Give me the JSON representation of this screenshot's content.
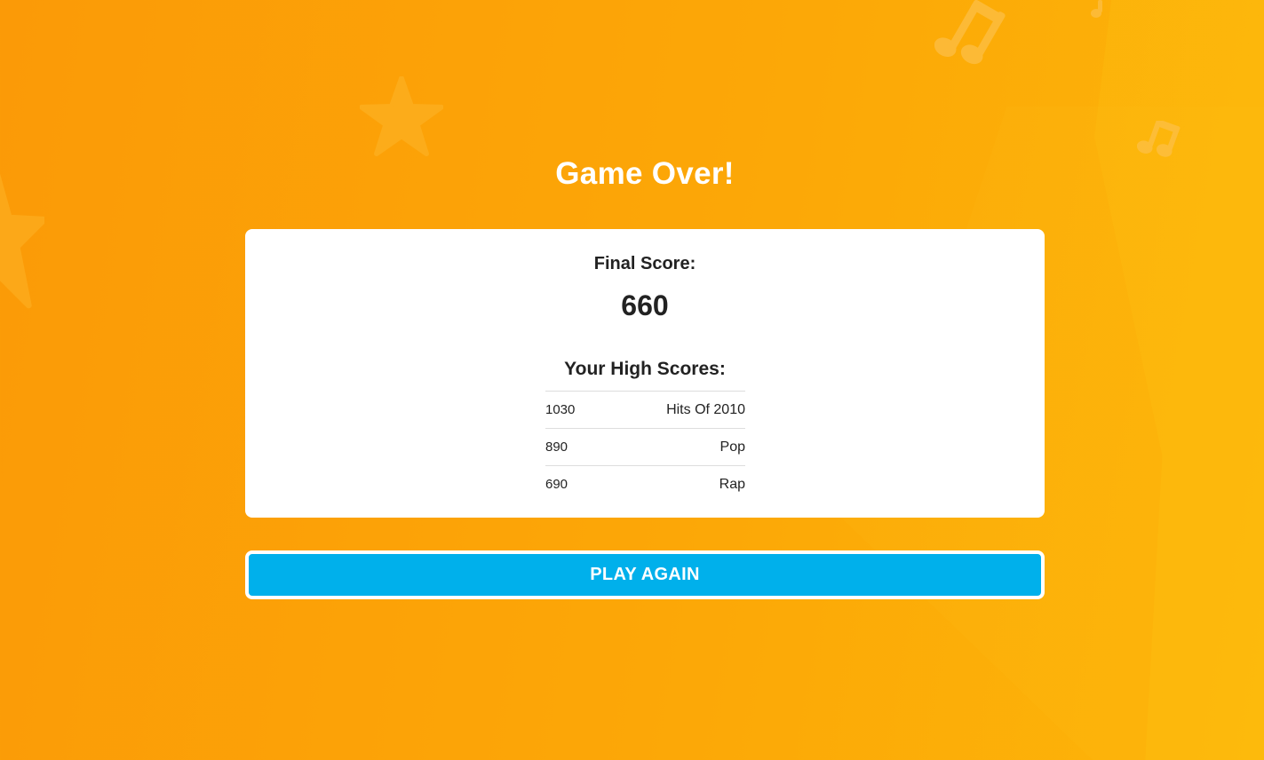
{
  "screen": {
    "title": "Game Over!"
  },
  "result": {
    "final_label": "Final Score:",
    "final_score": "660"
  },
  "high_scores": {
    "title": "Your High Scores:",
    "rows": [
      {
        "score": "1030",
        "category": "Hits Of 2010"
      },
      {
        "score": "890",
        "category": "Pop"
      },
      {
        "score": "690",
        "category": "Rap"
      }
    ]
  },
  "actions": {
    "play_again_label": "PLAY AGAIN"
  },
  "decorations": {
    "icons": [
      "star-icon",
      "music-note-icon"
    ]
  },
  "colors": {
    "background": "#fca707",
    "button": "#00b0eb",
    "card": "#ffffff",
    "text": "#222222"
  }
}
